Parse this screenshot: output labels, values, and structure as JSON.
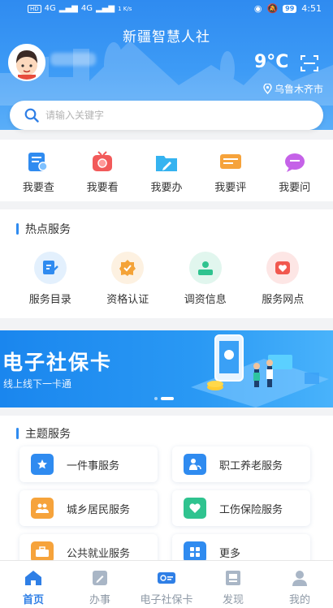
{
  "status_bar": {
    "carrier_left": "HD",
    "signal_1": "4G",
    "signal_2": "4G",
    "speed": "1 K/s",
    "battery": "99",
    "time": "4:51"
  },
  "header": {
    "title": "新疆智慧人社",
    "temperature": "9°C",
    "location": "乌鲁木齐市"
  },
  "search": {
    "placeholder": "请输入关键字"
  },
  "quick_actions": [
    {
      "label": "我要查",
      "icon": "search-doc-icon",
      "color": "#2f8bf0"
    },
    {
      "label": "我要看",
      "icon": "tv-icon",
      "color": "#f25a5a"
    },
    {
      "label": "我要办",
      "icon": "folder-edit-icon",
      "color": "#35b3f0"
    },
    {
      "label": "我要评",
      "icon": "comment-icon",
      "color": "#f6a33b"
    },
    {
      "label": "我要问",
      "icon": "chat-icon",
      "color": "#c562e8"
    }
  ],
  "hot_services": {
    "title": "热点服务",
    "items": [
      {
        "label": "服务目录",
        "icon": "catalog-icon",
        "color": "#2f8bf0",
        "bg": "#e3f0fd"
      },
      {
        "label": "资格认证",
        "icon": "badge-check-icon",
        "color": "#f4a338",
        "bg": "#fdf1e1"
      },
      {
        "label": "调资信息",
        "icon": "person-card-icon",
        "color": "#2fc38f",
        "bg": "#e1f6ee"
      },
      {
        "label": "服务网点",
        "icon": "heart-shield-icon",
        "color": "#f1584f",
        "bg": "#fde6e5"
      }
    ]
  },
  "banner": {
    "title": "电子社保卡",
    "subtitle": "线上线下一卡通",
    "slide_active": 2,
    "slide_count": 2
  },
  "theme_services": {
    "title": "主题服务",
    "items": [
      {
        "label": "一件事服务",
        "icon": "star-doc-icon",
        "color": "#2f8bf0"
      },
      {
        "label": "职工养老服务",
        "icon": "elder-care-icon",
        "color": "#2f8bf0"
      },
      {
        "label": "城乡居民服务",
        "icon": "residents-icon",
        "color": "#f6a33b"
      },
      {
        "label": "工伤保险服务",
        "icon": "heart-icon",
        "color": "#2fc38f"
      },
      {
        "label": "公共就业服务",
        "icon": "employment-icon",
        "color": "#f6a33b"
      },
      {
        "label": "更多",
        "icon": "grid-more-icon",
        "color": "#2f8bf0"
      }
    ]
  },
  "tab_bar": {
    "active": "首页",
    "tabs": [
      {
        "label": "首页",
        "icon": "home-icon"
      },
      {
        "label": "办事",
        "icon": "pen-doc-icon"
      },
      {
        "label": "电子社保卡",
        "icon": "card-icon"
      },
      {
        "label": "发现",
        "icon": "discover-icon"
      },
      {
        "label": "我的",
        "icon": "user-icon"
      }
    ]
  },
  "colors": {
    "primary": "#2f8bf0",
    "accent_tab": "#2f7fe6"
  }
}
